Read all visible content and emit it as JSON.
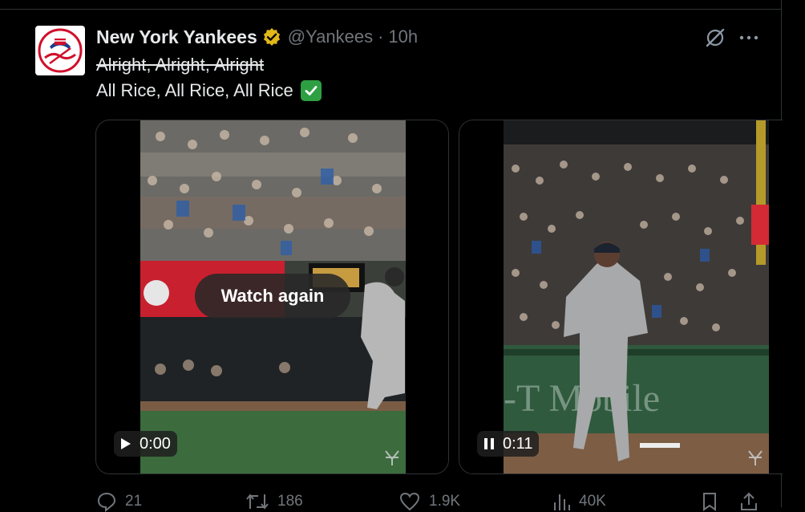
{
  "tweet": {
    "author_name": "New York Yankees",
    "handle": "@Yankees",
    "separator": "·",
    "time": "10h",
    "line1_struck": "Alright, Alright, Alright",
    "line2": "All Rice, All Rice, All Rice"
  },
  "video1": {
    "overlay_button": "Watch again",
    "time": "0:00",
    "state_icon": "play-icon"
  },
  "video2": {
    "time": "0:11",
    "state_icon": "pause-icon"
  },
  "actions": {
    "replies": "21",
    "reposts": "186",
    "likes": "1.9K",
    "views": "40K"
  },
  "colors": {
    "background": "#000000",
    "text": "#e7e9ea",
    "muted": "#71767b",
    "verified_gold": "#e2b719",
    "check_green": "#2ea043"
  }
}
